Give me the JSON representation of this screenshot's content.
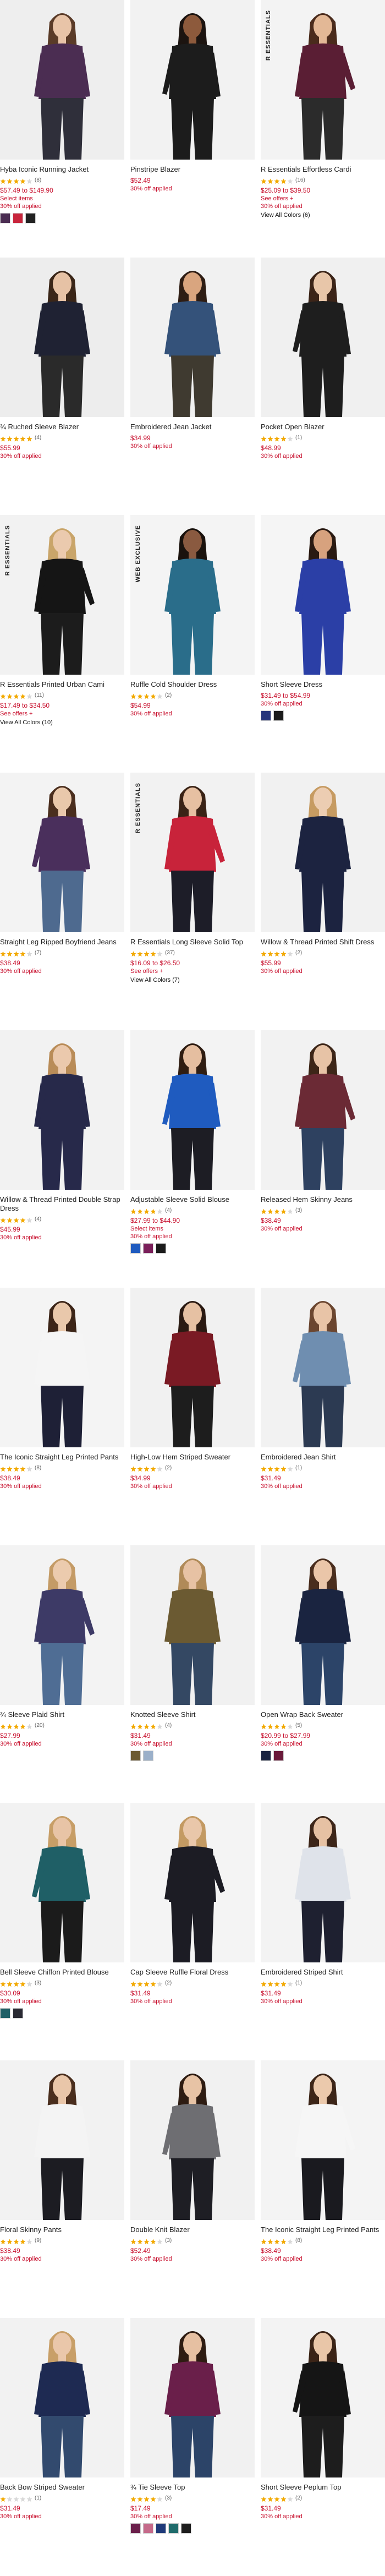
{
  "products": [
    {
      "name": "Hyba Iconic Running Jacket",
      "rating": 4,
      "reviews": "(8)",
      "price": "$57.49 to $149.90",
      "select_text": "Select items",
      "promo": "30% off applied",
      "colors_link": "",
      "swatches": [
        "#4b2d52",
        "#c8253c",
        "#222222"
      ],
      "badge": "",
      "photo": {
        "bg": "#eeeeee",
        "top": "#4b2d52",
        "bottom": "#2f2f3a",
        "skin": "#e8c4a8",
        "hair": "#5a3b28"
      }
    },
    {
      "name": "Pinstripe Blazer",
      "rating": 0,
      "reviews": "",
      "price": "$52.49",
      "select_text": "",
      "promo": "30% off applied",
      "colors_link": "",
      "swatches": [],
      "badge": "",
      "photo": {
        "bg": "#f2f2f2",
        "top": "#1c1c1c",
        "bottom": "#1c1c1c",
        "skin": "#8d5a3c",
        "hair": "#1c1410"
      }
    },
    {
      "name": "R Essentials Effortless Cardi",
      "rating": 4,
      "reviews": "(16)",
      "price": "$25.09 to $39.50",
      "select_text": "See offers +",
      "promo": "30% off applied",
      "colors_link": "View All Colors (6)",
      "swatches": [],
      "badge": "R ESSENTIALS",
      "photo": {
        "bg": "#f3f3f3",
        "top": "#5a1e34",
        "bottom": "#2b2b2b",
        "skin": "#e3b896",
        "hair": "#4a2b1c"
      }
    },
    {
      "name": "¾ Ruched Sleeve Blazer",
      "rating": 5,
      "reviews": "(4)",
      "price": "$55.99",
      "select_text": "",
      "promo": "30% off applied",
      "colors_link": "",
      "swatches": [],
      "badge": "",
      "photo": {
        "bg": "#ededed",
        "top": "#1f2233",
        "bottom": "#2a2a2a",
        "skin": "#e6c2a5",
        "hair": "#3a2618"
      }
    },
    {
      "name": "Embroidered Jean Jacket",
      "rating": 0,
      "reviews": "",
      "price": "$34.99",
      "select_text": "",
      "promo": "30% off applied",
      "colors_link": "",
      "swatches": [],
      "badge": "",
      "photo": {
        "bg": "#f1f1f1",
        "top": "#34527a",
        "bottom": "#3f3a30",
        "skin": "#d9a57f",
        "hair": "#2e1d14"
      }
    },
    {
      "name": "Pocket Open Blazer",
      "rating": 4,
      "reviews": "(1)",
      "price": "$48.99",
      "select_text": "",
      "promo": "30% off applied",
      "colors_link": "",
      "swatches": [],
      "badge": "",
      "photo": {
        "bg": "#f0f0f0",
        "top": "#1e1e1e",
        "bottom": "#1e1e1e",
        "skin": "#e8c6a9",
        "hair": "#3b2418"
      }
    },
    {
      "name": "R Essentials Printed Urban Cami",
      "rating": 4,
      "reviews": "(11)",
      "price": "$17.49 to $34.50",
      "select_text": "See offers +",
      "promo": "",
      "colors_link": "View All Colors (10)",
      "swatches": [],
      "badge": "R ESSENTIALS",
      "photo": {
        "bg": "#f2f2f2",
        "top": "#151515",
        "bottom": "#1c1c1c",
        "skin": "#ebcaae",
        "hair": "#c9a56a"
      }
    },
    {
      "name": "Ruffle Cold Shoulder Dress",
      "rating": 4,
      "reviews": "(2)",
      "price": "$54.99",
      "select_text": "",
      "promo": "30% off applied",
      "colors_link": "",
      "swatches": [],
      "badge": "WEB EXCLUSIVE",
      "photo": {
        "bg": "#f4f4f4",
        "top": "#2a6d8a",
        "bottom": "#2a6d8a",
        "skin": "#8a5a40",
        "hair": "#1a120d"
      }
    },
    {
      "name": "Short Sleeve Dress",
      "rating": 0,
      "reviews": "",
      "price": "$31.49 to $54.99",
      "select_text": "",
      "promo": "30% off applied",
      "colors_link": "",
      "swatches": [
        "#26357a",
        "#1b1b1b"
      ],
      "badge": "",
      "photo": {
        "bg": "#f5f5f5",
        "top": "#2b3fa6",
        "bottom": "#2b3fa6",
        "skin": "#d7a27e",
        "hair": "#2a1a12"
      }
    },
    {
      "name": "Straight Leg Ripped Boyfriend Jeans",
      "rating": 4,
      "reviews": "(7)",
      "price": "$38.49",
      "select_text": "",
      "promo": "30% off applied",
      "colors_link": "",
      "swatches": [],
      "badge": "",
      "photo": {
        "bg": "#f3f3f3",
        "top": "#4a2f5c",
        "bottom": "#4e6a8f",
        "skin": "#e9c8ab",
        "hair": "#4a2e1e"
      }
    },
    {
      "name": "R Essentials Long Sleeve Solid Top",
      "rating": 4,
      "reviews": "(37)",
      "price": "$16.09 to $26.50",
      "select_text": "See offers +",
      "promo": "",
      "colors_link": "View All Colors (7)",
      "swatches": [],
      "badge": "R ESSENTIALS",
      "photo": {
        "bg": "#f2f2f2",
        "top": "#c8233a",
        "bottom": "#1d1d28",
        "skin": "#e6c0a2",
        "hair": "#3a2316"
      }
    },
    {
      "name": "Willow & Thread Printed Shift Dress",
      "rating": 4,
      "reviews": "(2)",
      "price": "$55.99",
      "select_text": "",
      "promo": "30% off applied",
      "colors_link": "",
      "swatches": [],
      "badge": "",
      "photo": {
        "bg": "#f1f1f1",
        "top": "#1c2340",
        "bottom": "#1c2340",
        "skin": "#eccdb2",
        "hair": "#c69b62"
      }
    },
    {
      "name": "Willow & Thread Printed Double Strap Dress",
      "rating": 4,
      "reviews": "(4)",
      "price": "$45.99",
      "select_text": "",
      "promo": "30% off applied",
      "colors_link": "",
      "swatches": [],
      "badge": "",
      "photo": {
        "bg": "#f2f2f2",
        "top": "#27294a",
        "bottom": "#27294a",
        "skin": "#ebc9ad",
        "hair": "#b98c58"
      }
    },
    {
      "name": "Adjustable Sleeve Solid Blouse",
      "rating": 4,
      "reviews": "(4)",
      "price": "$27.99 to $44.90",
      "select_text": "Select items",
      "promo": "30% off applied",
      "colors_link": "",
      "swatches": [
        "#1f5bbf",
        "#7a1f5a",
        "#1b1b1b"
      ],
      "badge": "",
      "photo": {
        "bg": "#f3f3f3",
        "top": "#1f5bbf",
        "bottom": "#1d1d24",
        "skin": "#e5bea0",
        "hair": "#2f1d12"
      }
    },
    {
      "name": "Released Hem Skinny Jeans",
      "rating": 4,
      "reviews": "(3)",
      "price": "$38.49",
      "select_text": "",
      "promo": "30% off applied",
      "colors_link": "",
      "swatches": [],
      "badge": "",
      "photo": {
        "bg": "#f2f2f2",
        "top": "#6b2a35",
        "bottom": "#2e4160",
        "skin": "#e7c3a6",
        "hair": "#3d2618"
      }
    },
    {
      "name": "The Iconic Straight Leg Printed Pants",
      "rating": 4,
      "reviews": "(8)",
      "price": "$38.49",
      "select_text": "",
      "promo": "30% off applied",
      "colors_link": "",
      "swatches": [],
      "badge": "",
      "photo": {
        "bg": "#f4f4f4",
        "top": "#f5f5f5",
        "bottom": "#1e2036",
        "skin": "#e9c8ab",
        "hair": "#3c2518"
      }
    },
    {
      "name": "High-Low Hem Striped Sweater",
      "rating": 4,
      "reviews": "(2)",
      "price": "$34.99",
      "select_text": "",
      "promo": "30% off applied",
      "colors_link": "",
      "swatches": [],
      "badge": "",
      "photo": {
        "bg": "#f1f1f1",
        "top": "#7a1a24",
        "bottom": "#1d1d1d",
        "skin": "#e6c1a3",
        "hair": "#2a1a12"
      }
    },
    {
      "name": "Embroidered Jean Shirt",
      "rating": 4,
      "reviews": "(1)",
      "price": "$31.49",
      "select_text": "",
      "promo": "30% off applied",
      "colors_link": "",
      "swatches": [],
      "badge": "",
      "photo": {
        "bg": "#f2f2f2",
        "top": "#6f8eb0",
        "bottom": "#2c3a52",
        "skin": "#e8c4a7",
        "hair": "#6b4630"
      }
    },
    {
      "name": "¾ Sleeve Plaid Shirt",
      "rating": 4,
      "reviews": "(20)",
      "price": "$27.99",
      "select_text": "",
      "promo": "30% off applied",
      "colors_link": "",
      "swatches": [],
      "badge": "",
      "photo": {
        "bg": "#f3f3f3",
        "top": "#3d3a66",
        "bottom": "#4f6d94",
        "skin": "#eccbae",
        "hair": "#c49b66"
      }
    },
    {
      "name": "Knotted Sleeve Shirt",
      "rating": 4,
      "reviews": "(4)",
      "price": "$31.49",
      "select_text": "",
      "promo": "30% off applied",
      "colors_link": "",
      "swatches": [
        "#6b5a32",
        "#9bb0c9"
      ],
      "badge": "",
      "photo": {
        "bg": "#f1f1f1",
        "top": "#6b5a32",
        "bottom": "#344863",
        "skin": "#e7c2a4",
        "hair": "#b08a58"
      }
    },
    {
      "name": "Open Wrap Back Sweater",
      "rating": 4,
      "reviews": "(5)",
      "price": "$20.99 to $27.99",
      "select_text": "",
      "promo": "30% off applied",
      "colors_link": "",
      "swatches": [
        "#1a2440",
        "#6a1a3a"
      ],
      "badge": "",
      "photo": {
        "bg": "#f3f3f3",
        "top": "#1a2440",
        "bottom": "#2c4468",
        "skin": "#eac6a9",
        "hair": "#4a2e1e"
      }
    },
    {
      "name": "Bell Sleeve Chiffon Printed Blouse",
      "rating": 4,
      "reviews": "(3)",
      "price": "$30.09",
      "select_text": "",
      "promo": "30% off applied",
      "colors_link": "",
      "swatches": [
        "#1f5f66",
        "#2a2a33"
      ],
      "badge": "",
      "photo": {
        "bg": "#f2f2f2",
        "top": "#1f5f66",
        "bottom": "#1b1b1b",
        "skin": "#e8c4a6",
        "hair": "#c79e67"
      }
    },
    {
      "name": "Cap Sleeve Ruffle Floral Dress",
      "rating": 4,
      "reviews": "(2)",
      "price": "$31.49",
      "select_text": "",
      "promo": "30% off applied",
      "colors_link": "",
      "swatches": [],
      "badge": "",
      "photo": {
        "bg": "#f4f4f4",
        "top": "#1c1c24",
        "bottom": "#1c1c24",
        "skin": "#e9c7aa",
        "hair": "#c39a63"
      }
    },
    {
      "name": "Embroidered Striped Shirt",
      "rating": 4,
      "reviews": "(1)",
      "price": "$31.49",
      "select_text": "",
      "promo": "30% off applied",
      "colors_link": "",
      "swatches": [],
      "badge": "",
      "photo": {
        "bg": "#f3f3f3",
        "top": "#dfe3ea",
        "bottom": "#1e2030",
        "skin": "#e6c1a3",
        "hair": "#3d2619"
      }
    },
    {
      "name": "Floral Skinny Pants",
      "rating": 4,
      "reviews": "(9)",
      "price": "$38.49",
      "select_text": "",
      "promo": "30% off applied",
      "colors_link": "",
      "swatches": [],
      "badge": "",
      "photo": {
        "bg": "#f2f2f2",
        "top": "#f4f4f4",
        "bottom": "#1c1c22",
        "skin": "#e9c6a9",
        "hair": "#4a2e1e"
      }
    },
    {
      "name": "Double Knit Blazer",
      "rating": 4,
      "reviews": "(3)",
      "price": "$52.49",
      "select_text": "",
      "promo": "30% off applied",
      "colors_link": "",
      "swatches": [],
      "badge": "",
      "photo": {
        "bg": "#f1f1f1",
        "top": "#6e6e72",
        "bottom": "#1e1e24",
        "skin": "#e7c3a5",
        "hair": "#2e1c12"
      }
    },
    {
      "name": "The Iconic Straight Leg Printed Pants",
      "rating": 4,
      "reviews": "(8)",
      "price": "$38.49",
      "select_text": "",
      "promo": "30% off applied",
      "colors_link": "",
      "swatches": [],
      "badge": "",
      "photo": {
        "bg": "#f4f4f4",
        "top": "#f6f6f6",
        "bottom": "#1a1a1f",
        "skin": "#ebc9ac",
        "hair": "#3d2619"
      }
    },
    {
      "name": "Back Bow Striped Sweater",
      "rating": 1,
      "reviews": "(1)",
      "price": "$31.49",
      "select_text": "",
      "promo": "30% off applied",
      "colors_link": "",
      "swatches": [],
      "badge": "",
      "photo": {
        "bg": "#f2f2f2",
        "top": "#1e2a52",
        "bottom": "#324a6e",
        "skin": "#eac7aa",
        "hair": "#c89f68"
      }
    },
    {
      "name": "¾ Tie Sleeve Top",
      "rating": 4,
      "reviews": "(3)",
      "price": "$17.49",
      "select_text": "",
      "promo": "30% off applied",
      "colors_link": "",
      "swatches": [
        "#6a1f4a",
        "#c56a8a",
        "#1f3a7a",
        "#1f6b6b",
        "#1d1d1d"
      ],
      "badge": "",
      "photo": {
        "bg": "#f1f1f1",
        "top": "#6a1f4a",
        "bottom": "#2c4468",
        "skin": "#e6c0a2",
        "hair": "#2e1c12"
      }
    },
    {
      "name": "Short Sleeve Peplum Top",
      "rating": 4,
      "reviews": "(2)",
      "price": "$31.49",
      "select_text": "",
      "promo": "30% off applied",
      "colors_link": "",
      "swatches": [],
      "badge": "",
      "photo": {
        "bg": "#f3f3f3",
        "top": "#151515",
        "bottom": "#1d1d1d",
        "skin": "#e9c6a8",
        "hair": "#3b2417"
      }
    }
  ],
  "colors": {
    "star_filled": "#f2a900",
    "star_empty": "#d8d8d8",
    "price": "#c8102e",
    "promo": "#c8102e"
  }
}
